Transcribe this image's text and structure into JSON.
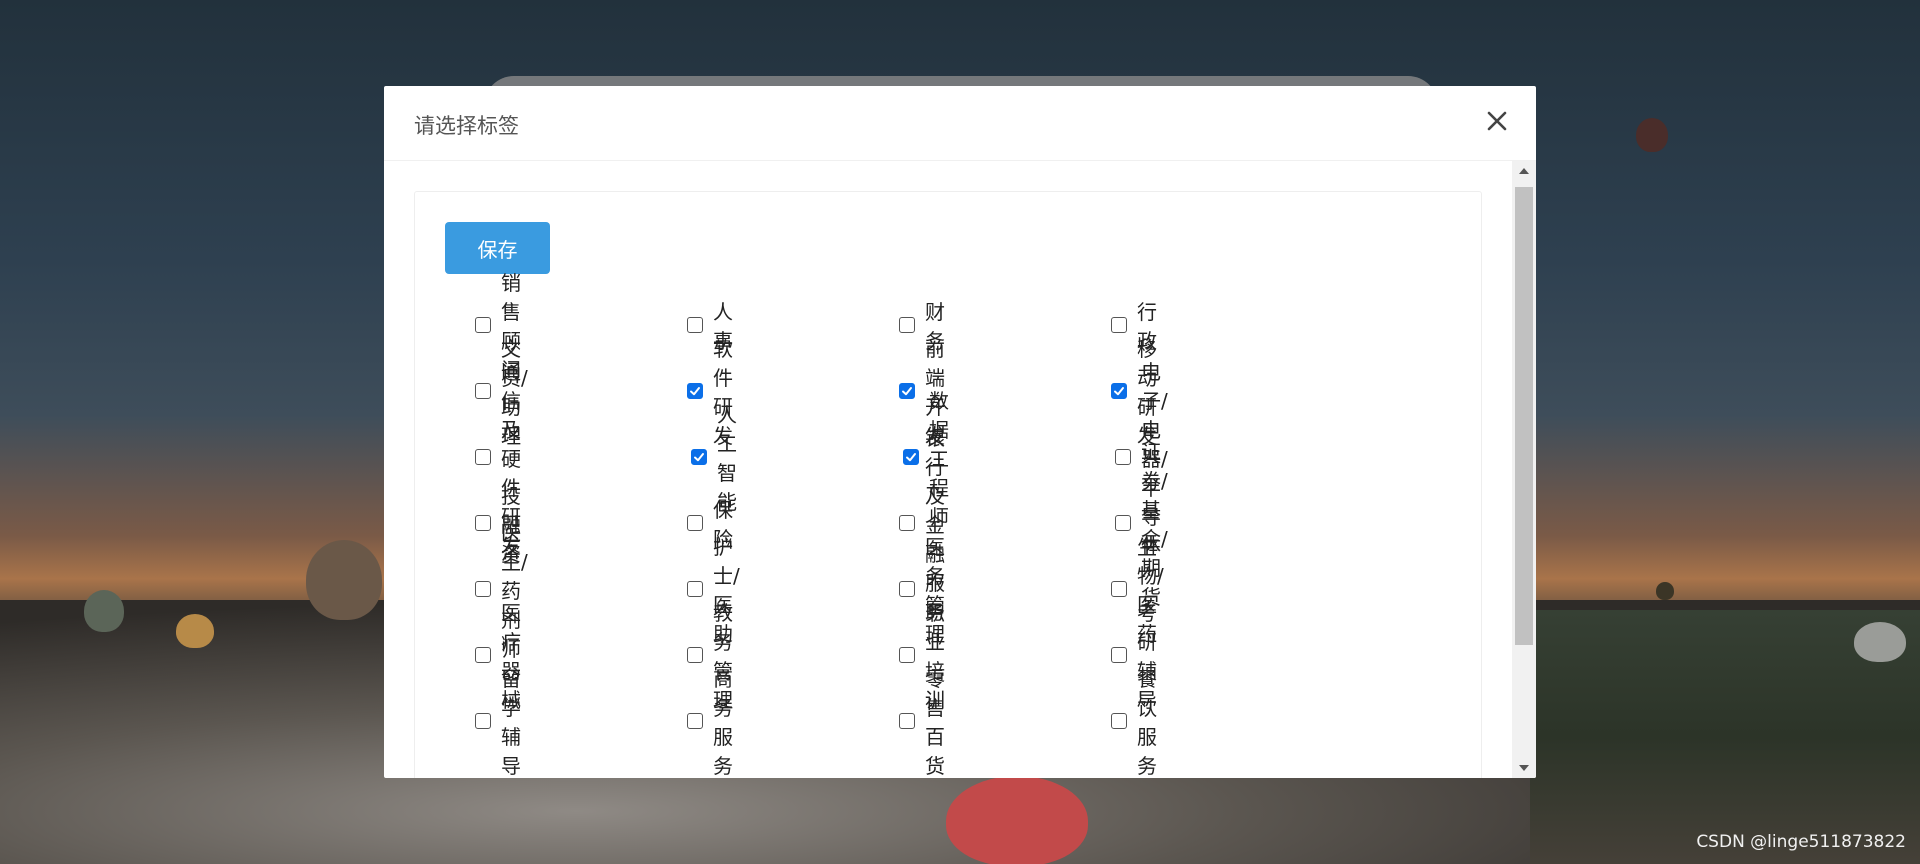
{
  "dialog": {
    "title": "请选择标签",
    "save_label": "保存"
  },
  "tags": [
    {
      "label": "销售顾问",
      "checked": false
    },
    {
      "label": "人事",
      "checked": false
    },
    {
      "label": "财务",
      "checked": false
    },
    {
      "label": "行政",
      "checked": false
    },
    {
      "label": "文员/助理",
      "checked": false
    },
    {
      "label": "软件研发",
      "checked": true
    },
    {
      "label": "前端开发",
      "checked": true
    },
    {
      "label": "移动研发",
      "checked": true
    },
    {
      "label": "通信及硬件研发",
      "checked": false
    },
    {
      "label": "人工智能",
      "checked": true
    },
    {
      "label": "数据工程师",
      "checked": true
    },
    {
      "label": "电子/电器/半导体",
      "checked": false
    },
    {
      "label": "投融资",
      "checked": false
    },
    {
      "label": "保险",
      "checked": false
    },
    {
      "label": "银行及金融服务",
      "checked": false
    },
    {
      "label": "证券/基金/期货",
      "checked": false
    },
    {
      "label": "医生/药剂师",
      "checked": false
    },
    {
      "label": "护士/医助",
      "checked": false
    },
    {
      "label": "医务管理",
      "checked": false
    },
    {
      "label": "生物/医药",
      "checked": false
    },
    {
      "label": "医疗器械",
      "checked": false
    },
    {
      "label": "教务管理",
      "checked": false
    },
    {
      "label": "职业培训",
      "checked": false
    },
    {
      "label": "考研辅导",
      "checked": false
    },
    {
      "label": "留学辅导",
      "checked": false
    },
    {
      "label": "商务服务",
      "checked": false
    },
    {
      "label": "零售百货",
      "checked": false
    },
    {
      "label": "餐饮服务",
      "checked": false
    }
  ],
  "watermark": "CSDN @linge511873822",
  "colors": {
    "accent": "#3a9be0",
    "checkbox_checked": "#0b6fe8"
  },
  "icons": {
    "close": "close-icon",
    "check": "checkmark-icon",
    "scroll_up": "triangle-up-icon",
    "scroll_down": "triangle-down-icon"
  }
}
